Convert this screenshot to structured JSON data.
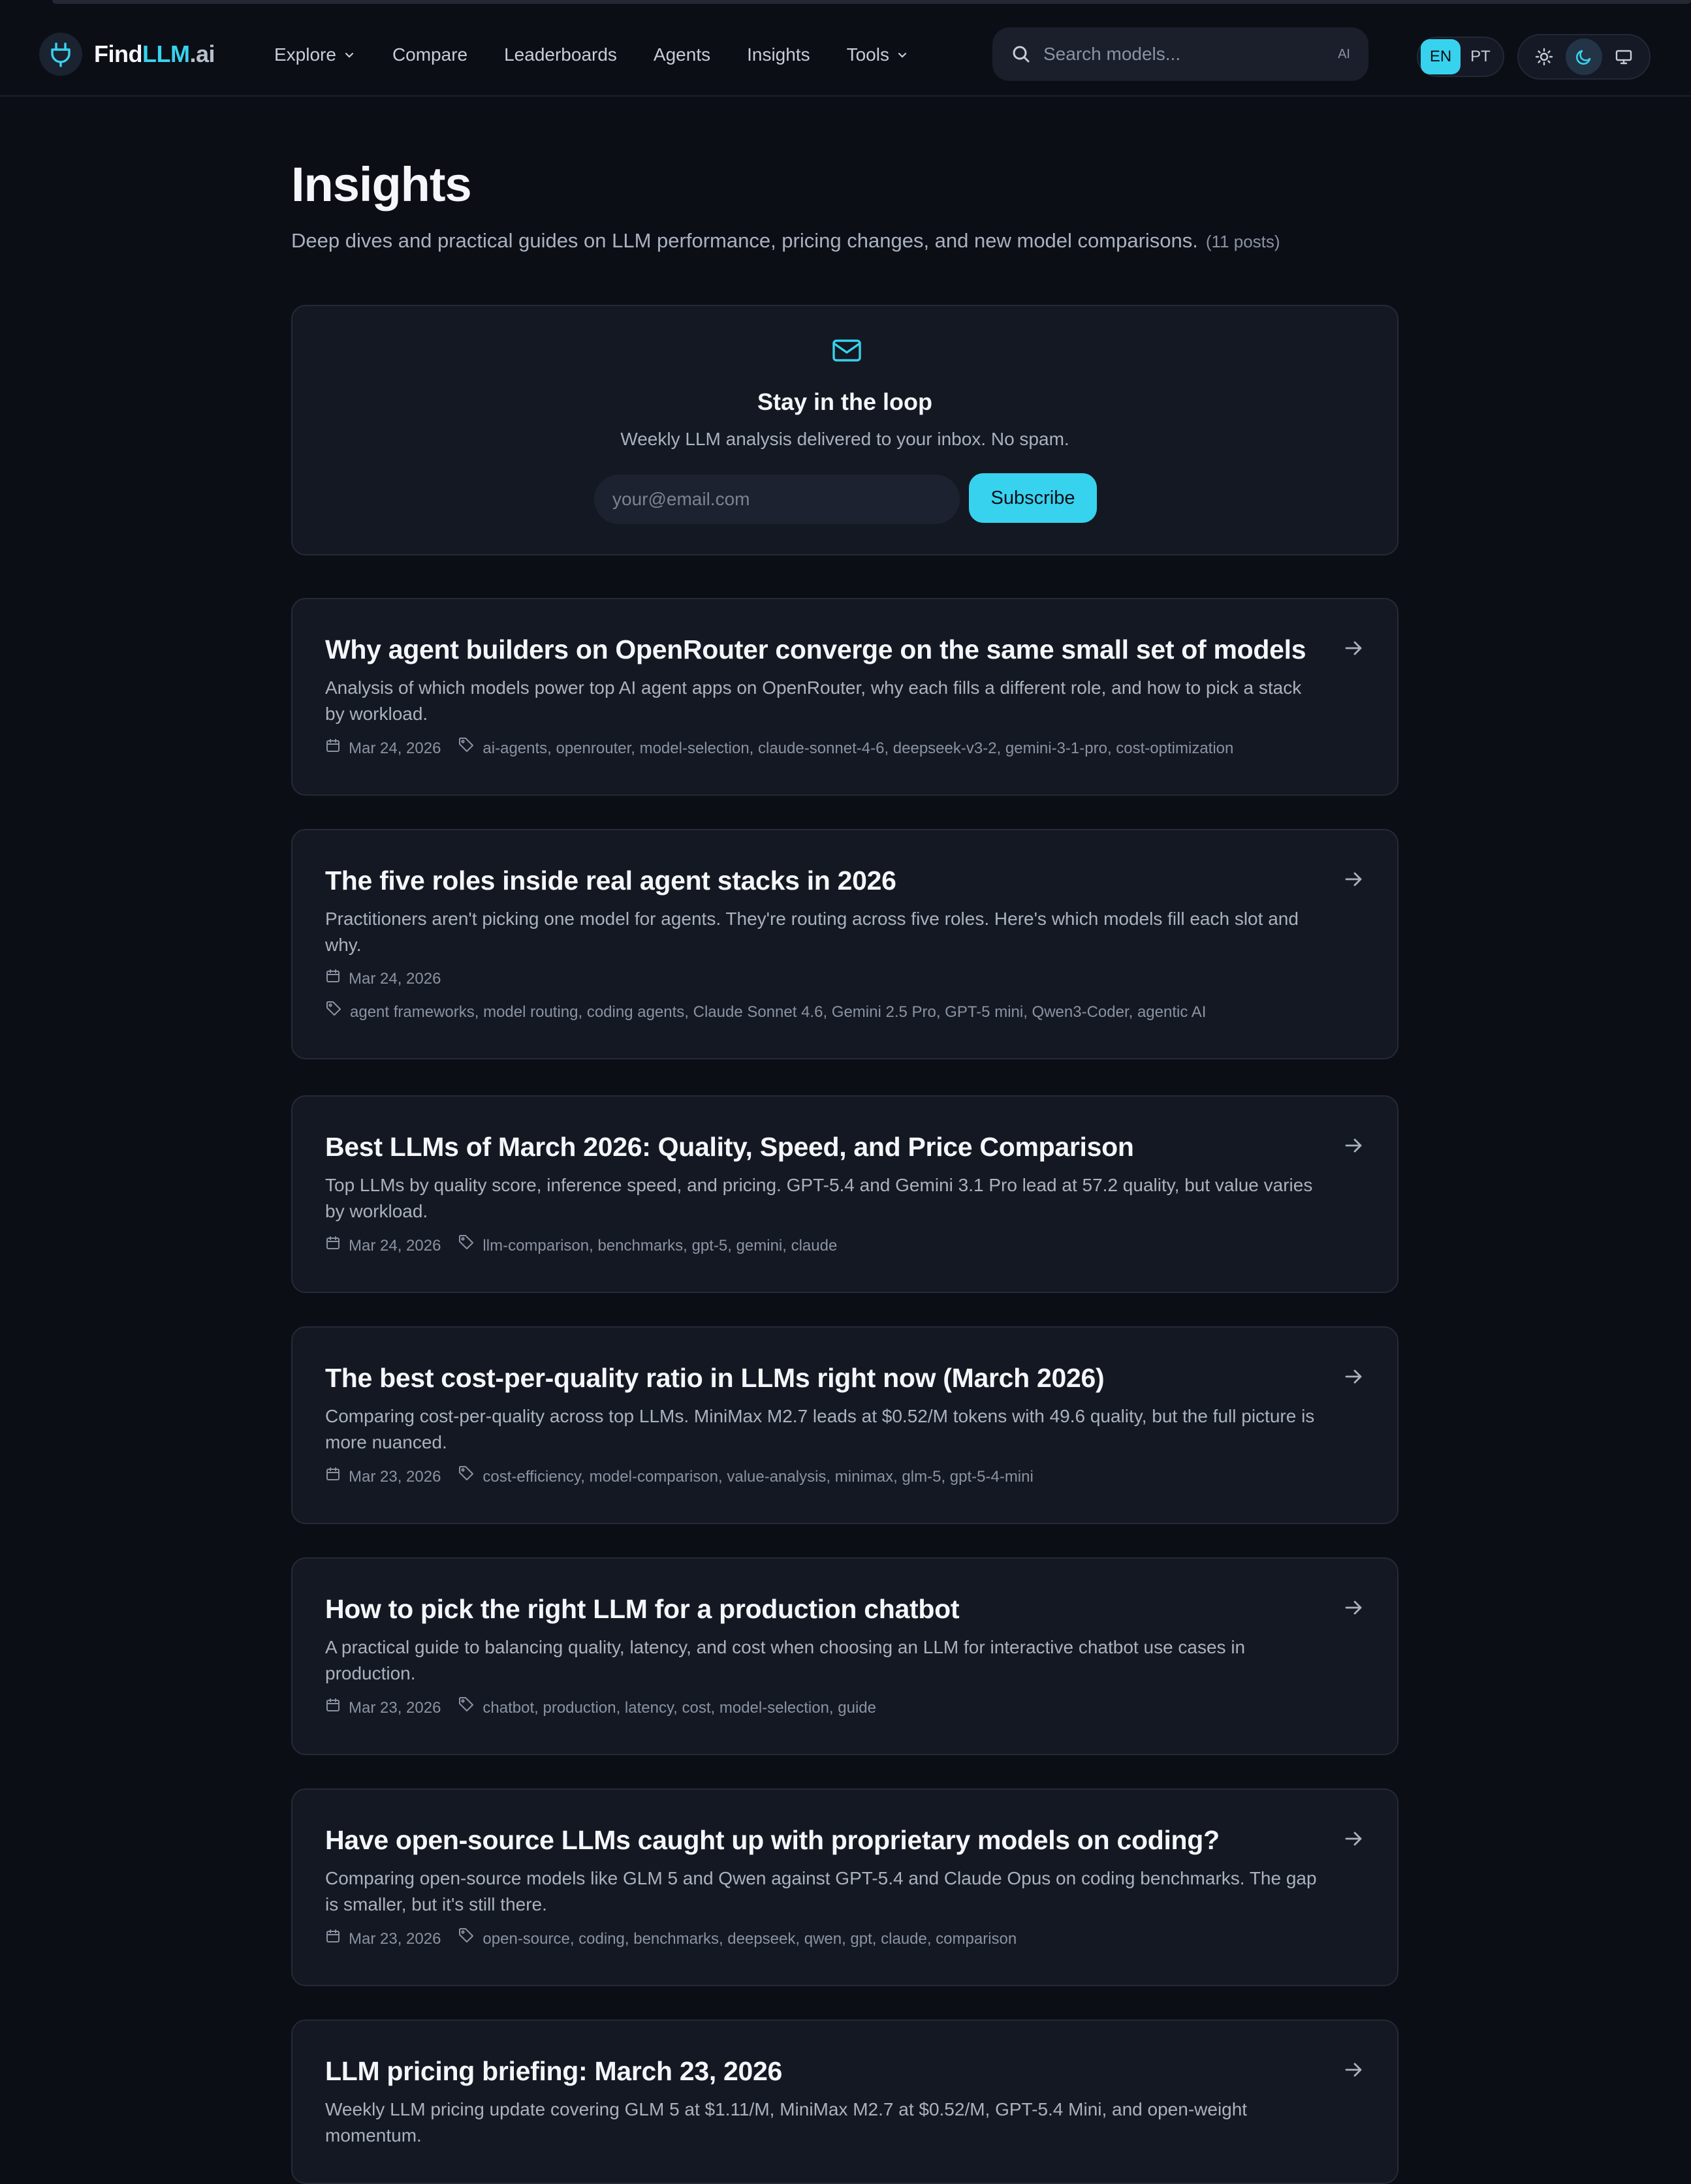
{
  "brand": {
    "find": "Find",
    "llm": "LLM",
    "ai": ".ai"
  },
  "nav": {
    "explore": "Explore",
    "compare": "Compare",
    "leaderboards": "Leaderboards",
    "agents": "Agents",
    "insights": "Insights",
    "tools": "Tools"
  },
  "search": {
    "placeholder": "Search models...",
    "ai_tag": "AI"
  },
  "lang": {
    "en": "EN",
    "pt": "PT",
    "active": "EN"
  },
  "theme": {
    "options": [
      "sun-icon",
      "moon-icon",
      "monitor-icon"
    ],
    "active": "moon-icon"
  },
  "page": {
    "title": "Insights",
    "subtitle": "Deep dives and practical guides on LLM performance, pricing changes, and new model comparisons.",
    "count": "(11 posts)"
  },
  "newsletter": {
    "title": "Stay in the loop",
    "subtitle": "Weekly LLM analysis delivered to your inbox. No spam.",
    "placeholder": "your@email.com",
    "button": "Subscribe"
  },
  "posts": [
    {
      "title": "Why agent builders on OpenRouter converge on the same small set of models",
      "desc": "Analysis of which models power top AI agent apps on OpenRouter, why each fills a different role, and how to pick a stack by workload.",
      "date": "Mar 24, 2026",
      "tags": "ai-agents, openrouter, model-selection, claude-sonnet-4-6, deepseek-v3-2, gemini-3-1-pro, cost-optimization"
    },
    {
      "title": "The five roles inside real agent stacks in 2026",
      "desc": "Practitioners aren't picking one model for agents. They're routing across five roles. Here's which models fill each slot and why.",
      "date": "Mar 24, 2026",
      "tags": "agent frameworks, model routing, coding agents, Claude Sonnet 4.6, Gemini 2.5 Pro, GPT-5 mini, Qwen3-Coder, agentic AI"
    },
    {
      "title": "Best LLMs of March 2026: Quality, Speed, and Price Comparison",
      "desc": "Top LLMs by quality score, inference speed, and pricing. GPT-5.4 and Gemini 3.1 Pro lead at 57.2 quality, but value varies by workload.",
      "date": "Mar 24, 2026",
      "tags": "llm-comparison, benchmarks, gpt-5, gemini, claude"
    },
    {
      "title": "The best cost-per-quality ratio in LLMs right now (March 2026)",
      "desc": "Comparing cost-per-quality across top LLMs. MiniMax M2.7 leads at $0.52/M tokens with 49.6 quality, but the full picture is more nuanced.",
      "date": "Mar 23, 2026",
      "tags": "cost-efficiency, model-comparison, value-analysis, minimax, glm-5, gpt-5-4-mini"
    },
    {
      "title": "How to pick the right LLM for a production chatbot",
      "desc": "A practical guide to balancing quality, latency, and cost when choosing an LLM for interactive chatbot use cases in production.",
      "date": "Mar 23, 2026",
      "tags": "chatbot, production, latency, cost, model-selection, guide"
    },
    {
      "title": "Have open-source LLMs caught up with proprietary models on coding?",
      "desc": "Comparing open-source models like GLM 5 and Qwen against GPT-5.4 and Claude Opus on coding benchmarks. The gap is smaller, but it's still there.",
      "date": "Mar 23, 2026",
      "tags": "open-source, coding, benchmarks, deepseek, qwen, gpt, claude, comparison"
    },
    {
      "title": "LLM pricing briefing: March 23, 2026",
      "desc": "Weekly LLM pricing update covering GLM 5 at $1.11/M, MiniMax M2.7 at $0.52/M, GPT-5.4 Mini, and open-weight momentum."
    }
  ],
  "colors": {
    "accent": "#37d2ee",
    "background": "#0b0e15",
    "card": "#141822"
  }
}
